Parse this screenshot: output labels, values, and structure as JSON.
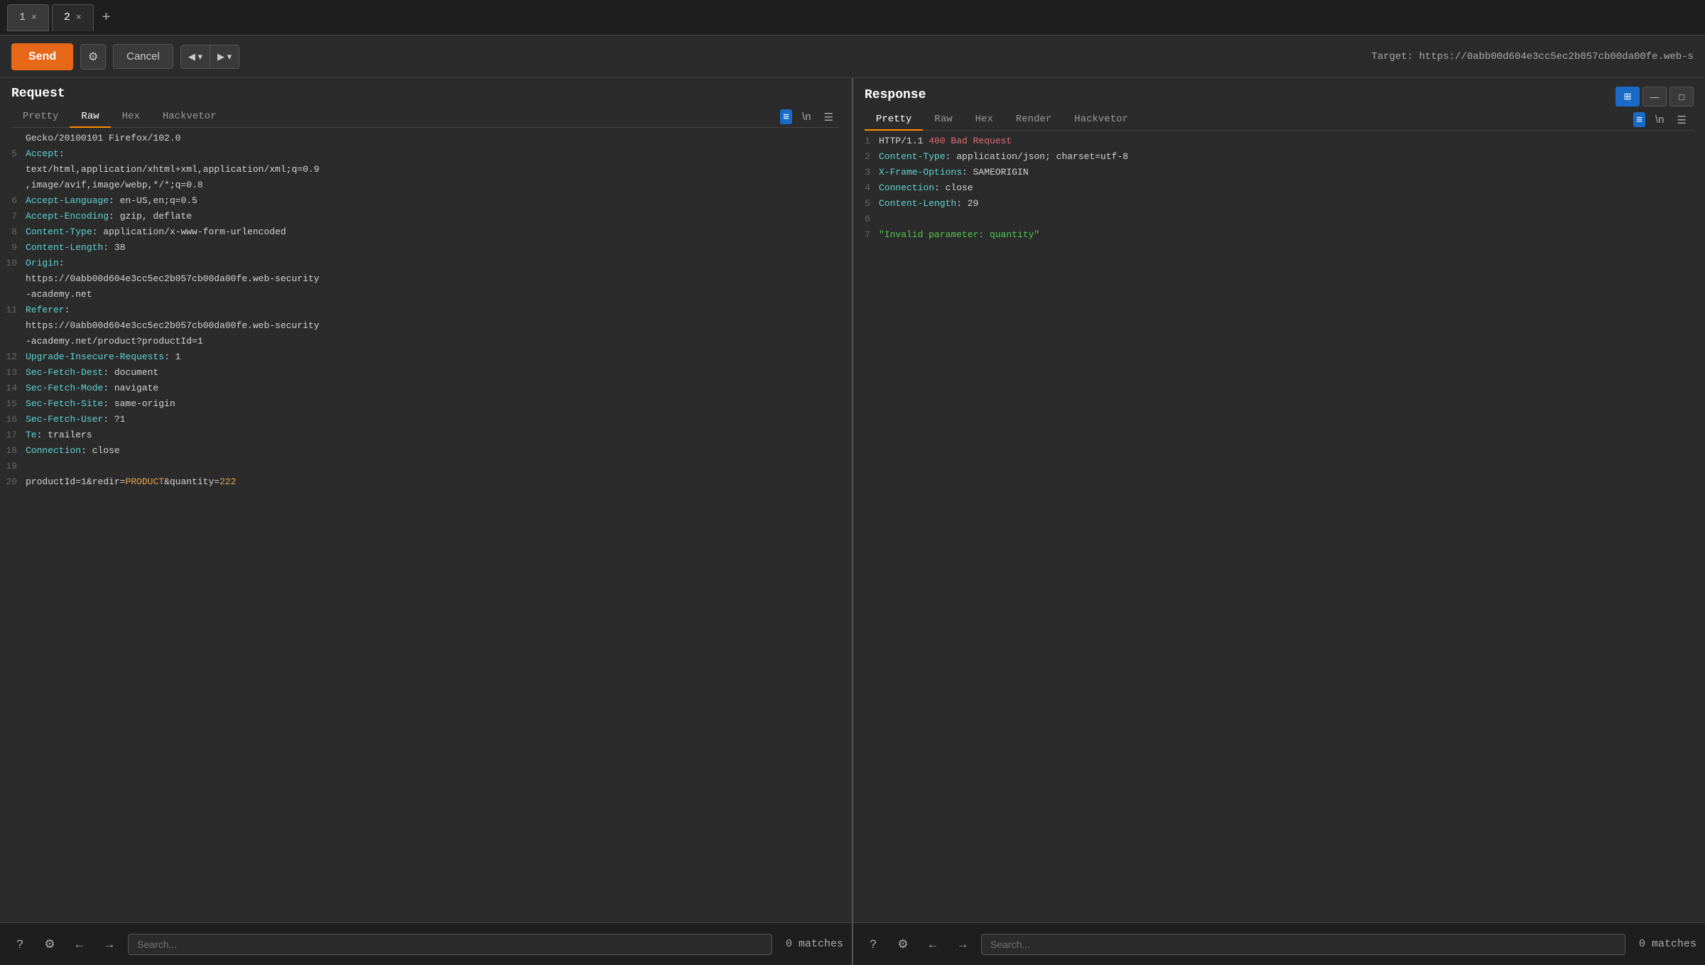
{
  "tabs": [
    {
      "id": 1,
      "label": "1",
      "closable": true,
      "active": false
    },
    {
      "id": 2,
      "label": "2",
      "closable": true,
      "active": true
    }
  ],
  "tab_add_label": "+",
  "toolbar": {
    "send_label": "Send",
    "cancel_label": "Cancel",
    "target_label": "Target: https://0abb00d604e3cc5ec2b057cb00da00fe.web-s"
  },
  "request": {
    "title": "Request",
    "tabs": [
      "Pretty",
      "Raw",
      "Hex",
      "Hackvetor"
    ],
    "active_tab": "Raw",
    "lines": [
      {
        "num": "",
        "content": "Gecko/20100101 Firefox/102.0"
      },
      {
        "num": "5",
        "content": "Accept:"
      },
      {
        "num": "",
        "content": "text/html,application/xhtml+xml,application/xml;q=0.9"
      },
      {
        "num": "",
        "content": ",image/avif,image/webp,*/*;q=0.8"
      },
      {
        "num": "6",
        "content": "Accept-Language: en-US,en;q=0.5"
      },
      {
        "num": "7",
        "content": "Accept-Encoding: gzip, deflate"
      },
      {
        "num": "8",
        "content": "Content-Type: application/x-www-form-urlencoded"
      },
      {
        "num": "9",
        "content": "Content-Length: 38"
      },
      {
        "num": "10",
        "content": "Origin:"
      },
      {
        "num": "",
        "content": "https://0abb00d604e3cc5ec2b057cb00da00fe.web-security"
      },
      {
        "num": "",
        "content": "-academy.net"
      },
      {
        "num": "11",
        "content": "Referer:"
      },
      {
        "num": "",
        "content": "https://0abb00d604e3cc5ec2b057cb00da00fe.web-security"
      },
      {
        "num": "",
        "content": "-academy.net/product?productId=1"
      },
      {
        "num": "12",
        "content": "Upgrade-Insecure-Requests: 1"
      },
      {
        "num": "13",
        "content": "Sec-Fetch-Dest: document"
      },
      {
        "num": "14",
        "content": "Sec-Fetch-Mode: navigate"
      },
      {
        "num": "15",
        "content": "Sec-Fetch-Site: same-origin"
      },
      {
        "num": "16",
        "content": "Sec-Fetch-User: ?1"
      },
      {
        "num": "17",
        "content": "Te: trailers"
      },
      {
        "num": "18",
        "content": "Connection: close"
      },
      {
        "num": "19",
        "content": ""
      },
      {
        "num": "20",
        "content": "productId=1&redir=PRODUCT&quantity=222",
        "special": true
      }
    ],
    "search_placeholder": "Search...",
    "matches_label": "0 matches"
  },
  "response": {
    "title": "Response",
    "tabs": [
      "Pretty",
      "Raw",
      "Hex",
      "Render",
      "Hackvetor"
    ],
    "active_tab": "Pretty",
    "lines": [
      {
        "num": "1",
        "content": "HTTP/1.1 400 Bad Request"
      },
      {
        "num": "2",
        "content": "Content-Type: application/json; charset=utf-8"
      },
      {
        "num": "3",
        "content": "X-Frame-Options: SAMEORIGIN"
      },
      {
        "num": "4",
        "content": "Connection: close"
      },
      {
        "num": "5",
        "content": "Content-Length: 29"
      },
      {
        "num": "6",
        "content": ""
      },
      {
        "num": "7",
        "content": "\"Invalid parameter: quantity\"",
        "special": true
      }
    ],
    "search_placeholder": "Search...",
    "matches_label": "0 matches"
  }
}
